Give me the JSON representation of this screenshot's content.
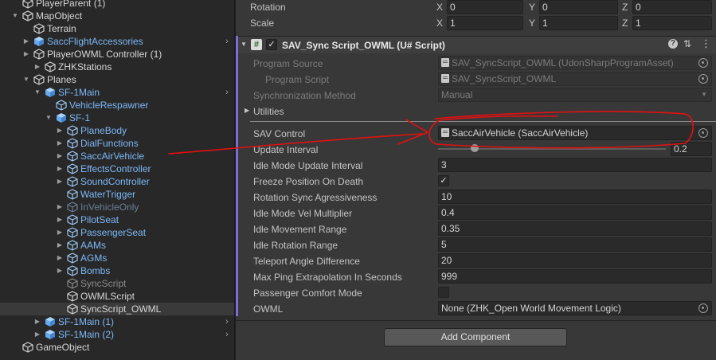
{
  "hierarchy": {
    "items": [
      {
        "label": "PlayerParent (1)",
        "color": "white",
        "icon": "cube-icon",
        "arrow": "",
        "chevron": false
      },
      {
        "label": "MapObject",
        "color": "white",
        "icon": "cube-icon",
        "arrow": "expanded",
        "chevron": false
      },
      {
        "label": "Terrain",
        "color": "white",
        "icon": "cube-icon",
        "arrow": "",
        "chevron": false
      },
      {
        "label": "SaccFlightAccessories",
        "color": "blue",
        "icon": "prefab-icon",
        "arrow": "collapsed",
        "chevron": true
      },
      {
        "label": "PlayerOWML Controller (1)",
        "color": "white",
        "icon": "cube-icon",
        "arrow": "collapsed",
        "chevron": false
      },
      {
        "label": "ZHKStations",
        "color": "white",
        "icon": "cube-icon",
        "arrow": "collapsed",
        "chevron": false
      },
      {
        "label": "Planes",
        "color": "white",
        "icon": "cube-icon",
        "arrow": "expanded",
        "chevron": false
      },
      {
        "label": "SF-1Main",
        "color": "blue",
        "icon": "prefab-icon",
        "arrow": "expanded",
        "chevron": true
      },
      {
        "label": "VehicleRespawner",
        "color": "blue",
        "icon": "cube-icon",
        "arrow": "",
        "chevron": false
      },
      {
        "label": "SF-1",
        "color": "blue",
        "icon": "prefab-icon",
        "arrow": "expanded",
        "chevron": false
      },
      {
        "label": "PlaneBody",
        "color": "blue",
        "icon": "cube-icon",
        "arrow": "collapsed",
        "chevron": false
      },
      {
        "label": "DialFunctions",
        "color": "blue",
        "icon": "cube-icon",
        "arrow": "collapsed",
        "chevron": false
      },
      {
        "label": "SaccAirVehicle",
        "color": "blue",
        "icon": "cube-icon",
        "arrow": "collapsed",
        "chevron": false
      },
      {
        "label": "EffectsController",
        "color": "blue",
        "icon": "cube-icon",
        "arrow": "collapsed",
        "chevron": false
      },
      {
        "label": "SoundController",
        "color": "blue",
        "icon": "cube-icon",
        "arrow": "collapsed",
        "chevron": false
      },
      {
        "label": "WaterTrigger",
        "color": "blue",
        "icon": "cube-icon",
        "arrow": "",
        "chevron": false
      },
      {
        "label": "InVehicleOnly",
        "color": "dim",
        "icon": "cube-icon",
        "arrow": "collapsed",
        "chevron": false
      },
      {
        "label": "PilotSeat",
        "color": "blue",
        "icon": "cube-icon",
        "arrow": "collapsed",
        "chevron": false
      },
      {
        "label": "PassengerSeat",
        "color": "blue",
        "icon": "cube-icon",
        "arrow": "collapsed",
        "chevron": false
      },
      {
        "label": "AAMs",
        "color": "blue",
        "icon": "cube-icon",
        "arrow": "collapsed",
        "chevron": false
      },
      {
        "label": "AGMs",
        "color": "blue",
        "icon": "cube-icon",
        "arrow": "collapsed",
        "chevron": false
      },
      {
        "label": "Bombs",
        "color": "blue",
        "icon": "cube-icon",
        "arrow": "collapsed",
        "chevron": false
      },
      {
        "label": "SyncScript",
        "color": "dimgray",
        "icon": "cube-icon",
        "arrow": "",
        "chevron": false
      },
      {
        "label": "OWMLScript",
        "color": "white",
        "icon": "cube-icon",
        "arrow": "",
        "chevron": false
      },
      {
        "label": "SyncScript_OWML",
        "color": "white",
        "icon": "cube-icon",
        "arrow": "",
        "chevron": false,
        "selected": true
      },
      {
        "label": "SF-1Main (1)",
        "color": "blue",
        "icon": "prefab-icon",
        "arrow": "collapsed",
        "chevron": true
      },
      {
        "label": "SF-1Main (2)",
        "color": "blue",
        "icon": "prefab-icon",
        "arrow": "collapsed",
        "chevron": true
      },
      {
        "label": "GameObject",
        "color": "white",
        "icon": "cube-icon",
        "arrow": "",
        "chevron": false
      }
    ]
  },
  "transform": {
    "rotation": {
      "label": "Rotation",
      "x": "0",
      "y": "0",
      "z": "0"
    },
    "scale": {
      "label": "Scale",
      "x": "1",
      "y": "1",
      "z": "1"
    },
    "axis_x": "X",
    "axis_y": "Y",
    "axis_z": "Z"
  },
  "component": {
    "title": "SAV_Sync Script_OWML (U# Script)",
    "icons": [
      "script-hash-icon",
      "help-icon",
      "preset-icon",
      "context-menu-icon"
    ]
  },
  "fields": {
    "program_source": {
      "label": "Program Source",
      "value": "SAV_SyncScript_OWML (UdonSharpProgramAsset)"
    },
    "program_script": {
      "label": "Program Script",
      "value": "SAV_SyncScript_OWML"
    },
    "sync_method": {
      "label": "Synchronization Method",
      "value": "Manual"
    },
    "utilities": {
      "label": "Utilities"
    },
    "sav_control": {
      "label": "SAV Control",
      "value": "SaccAirVehicle (SaccAirVehicle)"
    },
    "update_interval": {
      "label": "Update Interval",
      "value": "0.2",
      "slider_fraction": 0.16
    },
    "idle_update": {
      "label": "Idle Mode Update Interval",
      "value": "3"
    },
    "freeze_death": {
      "label": "Freeze Position On Death",
      "checked": "✓"
    },
    "rot_sync": {
      "label": "Rotation Sync Agressiveness",
      "value": "10"
    },
    "idle_vel": {
      "label": "Idle Mode Vel Multiplier",
      "value": "0.4"
    },
    "idle_move": {
      "label": "Idle Movement Range",
      "value": "0.35"
    },
    "idle_rot": {
      "label": "Idle Rotation Range",
      "value": "5"
    },
    "teleport": {
      "label": "Teleport Angle Difference",
      "value": "20"
    },
    "max_ping": {
      "label": "Max Ping Extrapolation In Seconds",
      "value": "999"
    },
    "passenger": {
      "label": "Passenger Comfort Mode",
      "checked": ""
    },
    "owml": {
      "label": "OWML",
      "value": "None (ZHK_Open World Movement Logic)"
    }
  },
  "add_component": "Add Component",
  "colors": {
    "accent": "#7b6fd6",
    "annotation_red": "#e31010",
    "label_blue": "#7cb8f6",
    "selection": "#3a3a3a"
  }
}
